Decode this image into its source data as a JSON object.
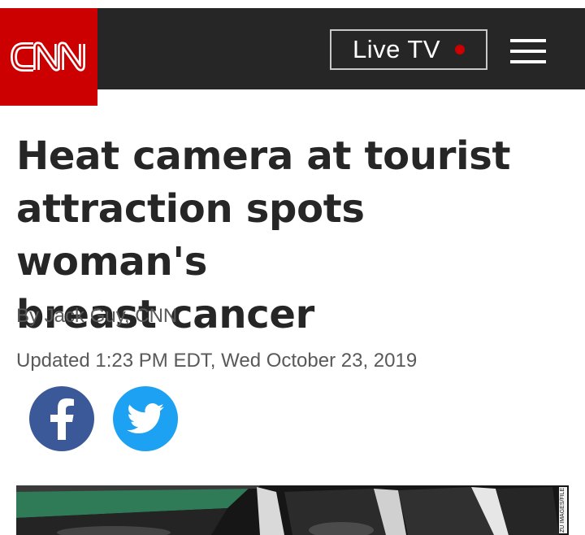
{
  "header": {
    "logo_text": "CNN",
    "live_tv_label": "Live TV",
    "colors": {
      "bar": "#262626",
      "brand_red": "#cc0000"
    }
  },
  "article": {
    "headline_lines": [
      "Heat camera at tourist",
      "attraction spots woman's",
      "breast cancer"
    ],
    "byline": "By Jack Guy, CNN",
    "updated": "Updated 1:23 PM EDT, Wed October 23, 2019"
  },
  "share": {
    "facebook_icon": "facebook-icon",
    "twitter_icon": "twitter-icon",
    "colors": {
      "facebook": "#3b5998",
      "twitter": "#1da1f2"
    }
  },
  "hero": {
    "credit": "ZU IMAGES/FILE"
  }
}
